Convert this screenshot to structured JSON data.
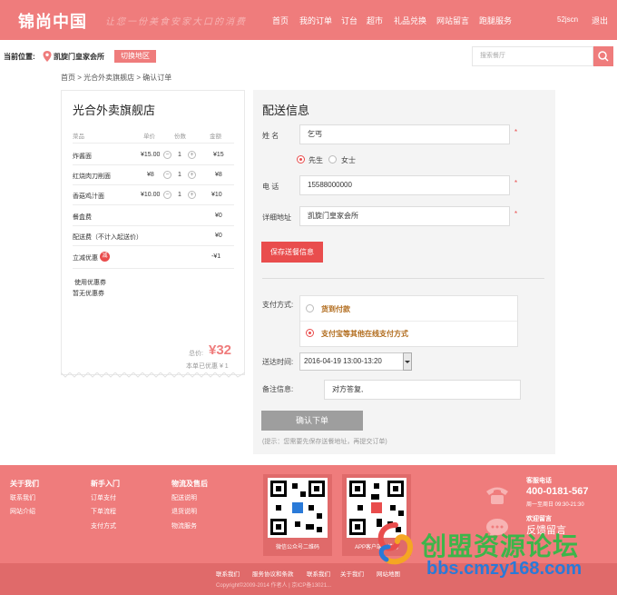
{
  "header": {
    "logo": "锦尚中国",
    "slogan": "让您一份美食安家大口的消费",
    "nav": [
      "首页",
      "我的订单",
      "订台",
      "超市",
      "礼品兑换",
      "网站留言",
      "跑腿服务"
    ],
    "user": "52jscn",
    "logout": "退出"
  },
  "location": {
    "label": "当前位置:",
    "name": "凯旋门皇家会所",
    "switch": "切换地区",
    "search_placeholder": "搜索餐厅"
  },
  "breadcrumb": "首页 > 光合外卖旗舰店 > 确认订单",
  "order": {
    "shop": "光合外卖旗舰店",
    "columns": [
      "菜品",
      "单价",
      "份数",
      "金额"
    ],
    "items": [
      {
        "name": "炸酱面",
        "price": "¥15.00",
        "qty": "1",
        "amount": "¥15"
      },
      {
        "name": "红烧肉刀削面",
        "price": "¥8",
        "qty": "1",
        "amount": "¥8"
      },
      {
        "name": "香菇鸡汁面",
        "price": "¥10.00",
        "qty": "1",
        "amount": "¥10"
      }
    ],
    "fees": [
      {
        "name": "餐盒费",
        "amount": "¥0"
      },
      {
        "name": "配送费（不计入起送价）",
        "amount": "¥0"
      },
      {
        "name": "立减优惠",
        "amount": "-¥1"
      }
    ],
    "discount_badge": "减",
    "coupon_use": "使用优惠券",
    "coupon_none": "暂无优惠券",
    "total_label": "总价:",
    "total": "¥32",
    "saved": "本单已优惠 ¥ 1"
  },
  "delivery": {
    "title": "配送信息",
    "name_label": "姓 名",
    "name_value": "乞丐",
    "gender": [
      "先生",
      "女士"
    ],
    "phone_label": "电 话",
    "phone_value": "15588000000",
    "address_label": "详细地址",
    "address_value": "凯旋门皇家会所",
    "required": "*",
    "save": "保存送餐信息",
    "pay_label": "支付方式:",
    "pay_options": [
      "货到付款",
      "支付宝等其他在线支付方式"
    ],
    "time_label": "送达时间:",
    "time_value": "2016-04-19 13:00-13:20",
    "remark_label": "备注信息:",
    "remark_value": "对方答复,",
    "confirm": "确认下单",
    "tip": "(提示：您需要先保存送餐地址，再提交订单)"
  },
  "footer": {
    "cols": [
      {
        "head": "关于我们",
        "links": [
          "联系我们",
          "网站介绍"
        ]
      },
      {
        "head": "新手入门",
        "links": [
          "订单支付",
          "下单流程",
          "支付方式"
        ]
      },
      {
        "head": "物流及售后",
        "links": [
          "配送说明",
          "退货说明",
          "物流服务"
        ]
      }
    ],
    "qr": [
      "微信公众号二维码",
      "APP客户端二维码"
    ],
    "phone_label": "客服电话",
    "phone": "400-0181-567",
    "hours": "周一至周日 09:30-21:30",
    "welcome": "欢迎留言",
    "feedback": "反馈留言",
    "bottom_links": [
      "联系我们",
      "服务协议和条款",
      "联系我们",
      "关于我们",
      "网站地图"
    ],
    "copyright": "Copyright©2009-2014 作者人 | 京ICP备13021..."
  },
  "watermark": {
    "text": "创盟资源论坛",
    "url": "bbs.cmzy168.com"
  },
  "colors": {
    "brand": "#ef7c7c",
    "accent": "#e94d4d",
    "watermark_green": "#3db54a",
    "watermark_blue": "#2a7ad8"
  }
}
